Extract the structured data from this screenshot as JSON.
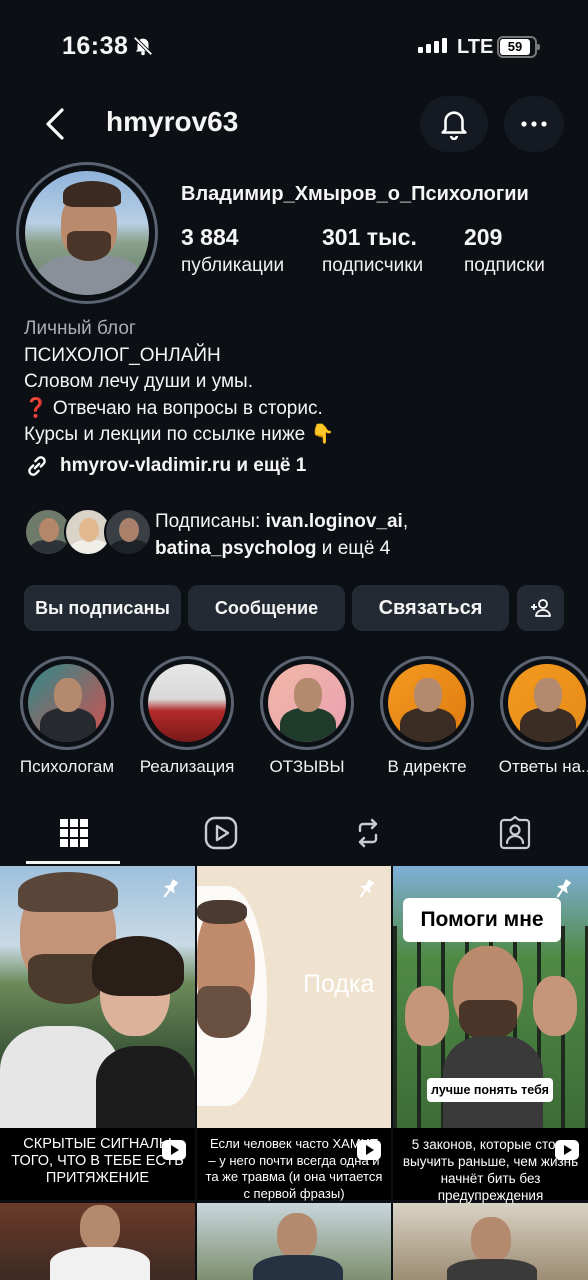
{
  "status": {
    "time": "16:38",
    "network": "LTE",
    "battery": "59"
  },
  "header": {
    "username": "hmyrov63"
  },
  "profile": {
    "display_name": "Владимир_Хмыров_о_Психологии",
    "stats": [
      {
        "value": "3 884",
        "label": "публикации"
      },
      {
        "value": "301 тыс.",
        "label": "подписчики"
      },
      {
        "value": "209",
        "label": "подписки"
      }
    ],
    "category": "Личный блог",
    "bio": [
      "ПСИХОЛОГ_ОНЛАЙН",
      "Словом лечу души и умы.",
      "❓ Отвечаю на вопросы в сторис.",
      "Курсы и лекции по ссылке ниже 👇"
    ],
    "link": "hmyrov-vladimir.ru и ещё 1"
  },
  "followed_by": {
    "prefix": "Подписаны: ",
    "user1": "ivan.loginov_ai",
    "comma": ",",
    "user2": "batina_psycholog",
    "suffix": " и ещё 4"
  },
  "actions": {
    "following": "Вы подписаны",
    "message": "Сообщение",
    "contact": "Связаться"
  },
  "highlights": [
    {
      "label": "Психологам"
    },
    {
      "label": "Реализация"
    },
    {
      "label": "ОТЗЫВЫ"
    },
    {
      "label": "В директе"
    },
    {
      "label": "Ответы на..."
    }
  ],
  "grid": [
    {
      "caption": "СКРЫТЫЕ СИГНАЛЫ ТОГО, ЧТО В ТЕБЕ ЕСТЬ ПРИТЯЖЕНИЕ",
      "overlay": ""
    },
    {
      "caption": "Если человек часто ХАМИТ – у него почти всегда одна и та же травма (и она читается с первой фразы)",
      "overlay": "Подка"
    },
    {
      "caption": "5 законов, которые стоит выучить раньше, чем жизнь начнёт бить без предупреждения",
      "overlay": "Помоги мне",
      "overlay2": "лучше понять тебя"
    }
  ],
  "colors": {
    "background": "#0c0f14",
    "button": "#242a33",
    "ring": "#5b6270"
  }
}
